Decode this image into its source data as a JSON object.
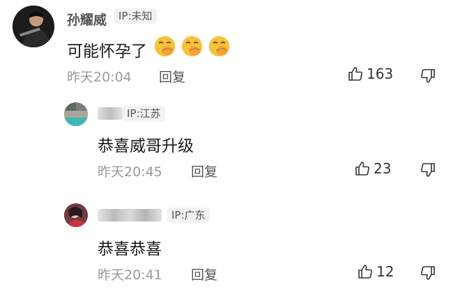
{
  "comments": [
    {
      "username": "孙耀威",
      "ip": "IP:未知",
      "text": "可能怀孕了",
      "emoji": "face-with-hand-over-mouth",
      "timestamp": "昨天20:04",
      "reply_label": "回复",
      "likes": "163"
    },
    {
      "username": "",
      "ip": "IP:江苏",
      "text": "恭喜威哥升级",
      "timestamp": "昨天20:45",
      "reply_label": "回复",
      "likes": "23"
    },
    {
      "username": "",
      "ip": "IP:广东",
      "text": "恭喜恭喜",
      "timestamp": "昨天20:41",
      "reply_label": "回复",
      "likes": "12"
    }
  ],
  "colors": {
    "text_primary": "#1a1a1a",
    "text_secondary": "#555555",
    "timestamp": "#9a9a9a",
    "ip_badge_bg": "#f2f2f2"
  }
}
